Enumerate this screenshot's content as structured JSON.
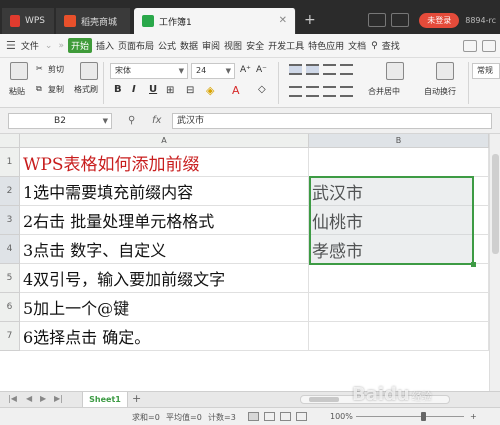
{
  "titlebar": {
    "tabs": [
      {
        "label": "WPS"
      },
      {
        "label": "稻壳商城"
      },
      {
        "label": "工作簿1"
      }
    ],
    "login_button": "未登录",
    "user_id": "8894-rc"
  },
  "menubar": {
    "file": "文件",
    "items": [
      "开始",
      "插入",
      "页面布局",
      "公式",
      "数据",
      "审阅",
      "视图",
      "安全",
      "开发工具",
      "特色应用",
      "文档"
    ],
    "search": "查找"
  },
  "ribbon": {
    "paste": "粘贴",
    "cut": "剪切",
    "copy": "复制",
    "format_painter": "格式刷",
    "font_name": "宋体",
    "font_size": "24",
    "merge_center": "合并居中",
    "wrap_text": "自动换行",
    "normal": "常规"
  },
  "formula": {
    "cell_ref": "B2",
    "fx": "fx",
    "value": "武汉市"
  },
  "grid": {
    "columns": [
      "A",
      "B"
    ],
    "rows": [
      "1",
      "2",
      "3",
      "4",
      "5",
      "6",
      "7"
    ],
    "colA": [
      "WPS表格如何添加前缀",
      "1选中需要填充前缀内容",
      "2右击   批量处理单元格格式",
      "3点击   数字、自定义",
      "4双引号，输入要加前缀文字",
      "5加上一个@键",
      "6选择点击   确定。"
    ],
    "colB": [
      "",
      "武汉市",
      "仙桃市",
      "孝感市",
      "",
      "",
      ""
    ]
  },
  "sheets": {
    "active": "Sheet1"
  },
  "status": {
    "sum": "求和=0",
    "avg": "平均值=0",
    "count": "计数=3",
    "zoom": "100%",
    "zoom_level": 1.0
  },
  "watermark": "Baidu",
  "watermark_suffix": "经验",
  "colors": {
    "accent_green": "#3d9b44",
    "title_red": "#c81e1e",
    "login_red": "#e44b3a"
  }
}
